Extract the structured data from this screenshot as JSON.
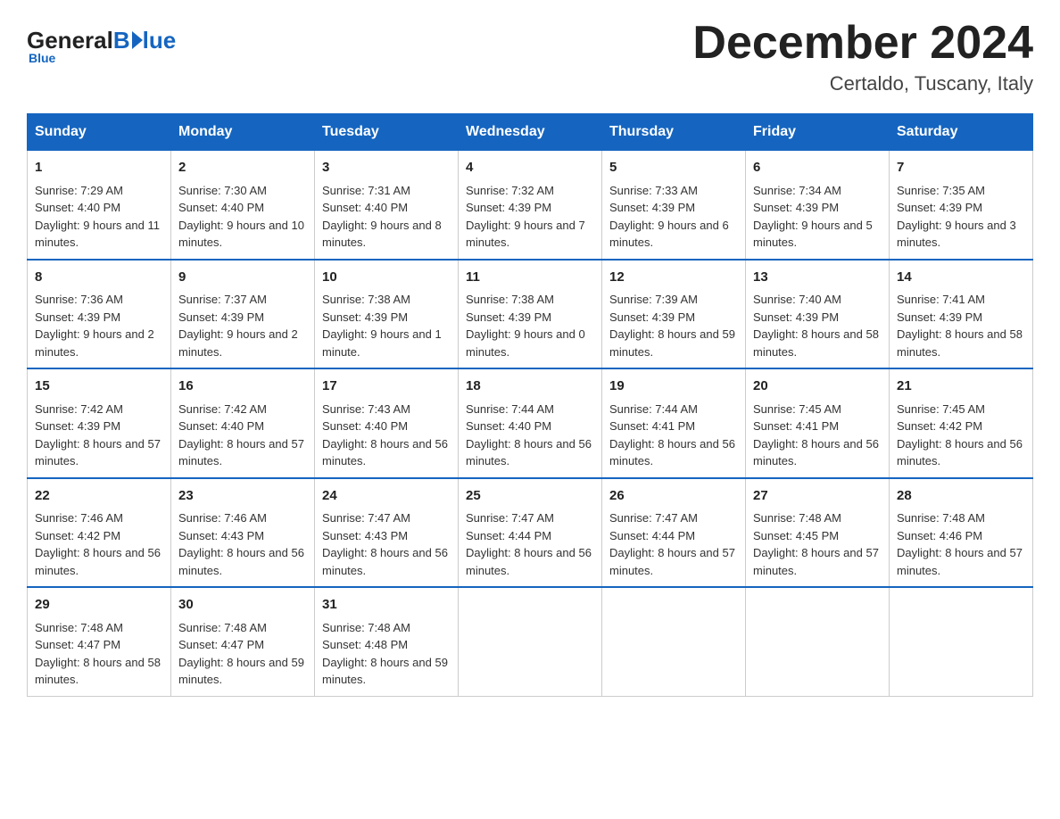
{
  "header": {
    "logo": {
      "general": "General",
      "blue": "Blue"
    },
    "month_year": "December 2024",
    "location": "Certaldo, Tuscany, Italy"
  },
  "days_of_week": [
    "Sunday",
    "Monday",
    "Tuesday",
    "Wednesday",
    "Thursday",
    "Friday",
    "Saturday"
  ],
  "weeks": [
    [
      {
        "day": "1",
        "sunrise": "7:29 AM",
        "sunset": "4:40 PM",
        "daylight": "9 hours and 11 minutes."
      },
      {
        "day": "2",
        "sunrise": "7:30 AM",
        "sunset": "4:40 PM",
        "daylight": "9 hours and 10 minutes."
      },
      {
        "day": "3",
        "sunrise": "7:31 AM",
        "sunset": "4:40 PM",
        "daylight": "9 hours and 8 minutes."
      },
      {
        "day": "4",
        "sunrise": "7:32 AM",
        "sunset": "4:39 PM",
        "daylight": "9 hours and 7 minutes."
      },
      {
        "day": "5",
        "sunrise": "7:33 AM",
        "sunset": "4:39 PM",
        "daylight": "9 hours and 6 minutes."
      },
      {
        "day": "6",
        "sunrise": "7:34 AM",
        "sunset": "4:39 PM",
        "daylight": "9 hours and 5 minutes."
      },
      {
        "day": "7",
        "sunrise": "7:35 AM",
        "sunset": "4:39 PM",
        "daylight": "9 hours and 3 minutes."
      }
    ],
    [
      {
        "day": "8",
        "sunrise": "7:36 AM",
        "sunset": "4:39 PM",
        "daylight": "9 hours and 2 minutes."
      },
      {
        "day": "9",
        "sunrise": "7:37 AM",
        "sunset": "4:39 PM",
        "daylight": "9 hours and 2 minutes."
      },
      {
        "day": "10",
        "sunrise": "7:38 AM",
        "sunset": "4:39 PM",
        "daylight": "9 hours and 1 minute."
      },
      {
        "day": "11",
        "sunrise": "7:38 AM",
        "sunset": "4:39 PM",
        "daylight": "9 hours and 0 minutes."
      },
      {
        "day": "12",
        "sunrise": "7:39 AM",
        "sunset": "4:39 PM",
        "daylight": "8 hours and 59 minutes."
      },
      {
        "day": "13",
        "sunrise": "7:40 AM",
        "sunset": "4:39 PM",
        "daylight": "8 hours and 58 minutes."
      },
      {
        "day": "14",
        "sunrise": "7:41 AM",
        "sunset": "4:39 PM",
        "daylight": "8 hours and 58 minutes."
      }
    ],
    [
      {
        "day": "15",
        "sunrise": "7:42 AM",
        "sunset": "4:39 PM",
        "daylight": "8 hours and 57 minutes."
      },
      {
        "day": "16",
        "sunrise": "7:42 AM",
        "sunset": "4:40 PM",
        "daylight": "8 hours and 57 minutes."
      },
      {
        "day": "17",
        "sunrise": "7:43 AM",
        "sunset": "4:40 PM",
        "daylight": "8 hours and 56 minutes."
      },
      {
        "day": "18",
        "sunrise": "7:44 AM",
        "sunset": "4:40 PM",
        "daylight": "8 hours and 56 minutes."
      },
      {
        "day": "19",
        "sunrise": "7:44 AM",
        "sunset": "4:41 PM",
        "daylight": "8 hours and 56 minutes."
      },
      {
        "day": "20",
        "sunrise": "7:45 AM",
        "sunset": "4:41 PM",
        "daylight": "8 hours and 56 minutes."
      },
      {
        "day": "21",
        "sunrise": "7:45 AM",
        "sunset": "4:42 PM",
        "daylight": "8 hours and 56 minutes."
      }
    ],
    [
      {
        "day": "22",
        "sunrise": "7:46 AM",
        "sunset": "4:42 PM",
        "daylight": "8 hours and 56 minutes."
      },
      {
        "day": "23",
        "sunrise": "7:46 AM",
        "sunset": "4:43 PM",
        "daylight": "8 hours and 56 minutes."
      },
      {
        "day": "24",
        "sunrise": "7:47 AM",
        "sunset": "4:43 PM",
        "daylight": "8 hours and 56 minutes."
      },
      {
        "day": "25",
        "sunrise": "7:47 AM",
        "sunset": "4:44 PM",
        "daylight": "8 hours and 56 minutes."
      },
      {
        "day": "26",
        "sunrise": "7:47 AM",
        "sunset": "4:44 PM",
        "daylight": "8 hours and 57 minutes."
      },
      {
        "day": "27",
        "sunrise": "7:48 AM",
        "sunset": "4:45 PM",
        "daylight": "8 hours and 57 minutes."
      },
      {
        "day": "28",
        "sunrise": "7:48 AM",
        "sunset": "4:46 PM",
        "daylight": "8 hours and 57 minutes."
      }
    ],
    [
      {
        "day": "29",
        "sunrise": "7:48 AM",
        "sunset": "4:47 PM",
        "daylight": "8 hours and 58 minutes."
      },
      {
        "day": "30",
        "sunrise": "7:48 AM",
        "sunset": "4:47 PM",
        "daylight": "8 hours and 59 minutes."
      },
      {
        "day": "31",
        "sunrise": "7:48 AM",
        "sunset": "4:48 PM",
        "daylight": "8 hours and 59 minutes."
      },
      null,
      null,
      null,
      null
    ]
  ],
  "labels": {
    "sunrise": "Sunrise:",
    "sunset": "Sunset:",
    "daylight": "Daylight:"
  }
}
